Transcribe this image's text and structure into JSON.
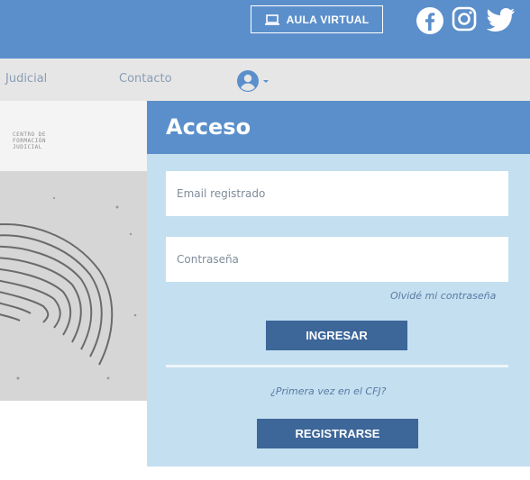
{
  "topbar": {
    "aula_button_label": "AULA VIRTUAL",
    "social": [
      "facebook-icon",
      "instagram-icon",
      "twitter-icon"
    ],
    "bg_color": "#5b8fcb"
  },
  "nav": {
    "items": [
      {
        "label": "Judicial"
      },
      {
        "label": "Contacto"
      }
    ],
    "user_icon": "user-circle-icon"
  },
  "hero": {
    "logo_lines": [
      "CENTRO DE",
      "FORMACIÓN",
      "JUDICIAL"
    ]
  },
  "login": {
    "title": "Acceso",
    "email_placeholder": "Email registrado",
    "password_placeholder": "Contraseña",
    "forgot_label": "Olvidé mi contraseña",
    "submit_label": "INGRESAR",
    "first_time_text": "¿Primera vez en el CFJ?",
    "register_label": "REGISTRARSE"
  },
  "colors": {
    "header_blue": "#5b8fcb",
    "panel_bg": "#c4dff0",
    "button_blue": "#3d6699",
    "nav_bg": "#e6e6e6"
  }
}
